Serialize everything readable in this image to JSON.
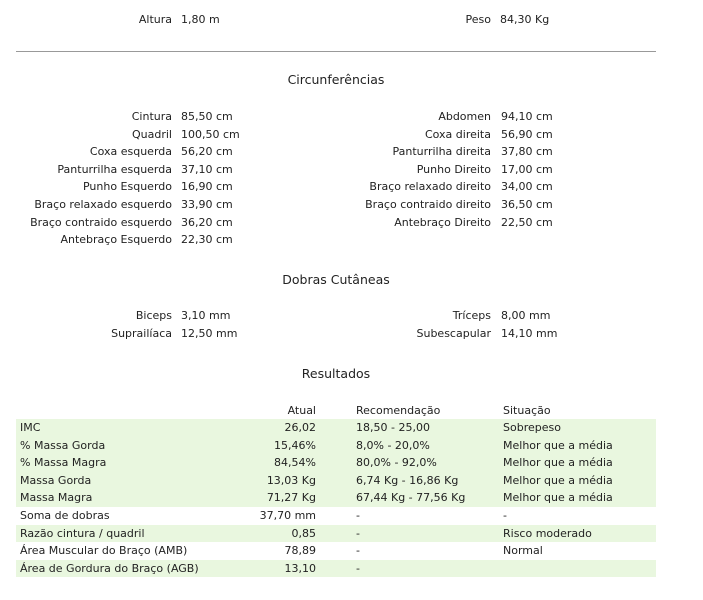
{
  "header": {
    "altura": {
      "label": "Altura",
      "value": "1,80 m"
    },
    "peso": {
      "label": "Peso",
      "value": "84,30 Kg"
    }
  },
  "circunferencias": {
    "title": "Circunferências",
    "left": [
      {
        "label": "Cintura",
        "value": "85,50 cm"
      },
      {
        "label": "Quadril",
        "value": "100,50 cm"
      },
      {
        "label": "Coxa esquerda",
        "value": "56,20 cm"
      },
      {
        "label": "Panturrilha esquerda",
        "value": "37,10 cm"
      },
      {
        "label": "Punho Esquerdo",
        "value": "16,90 cm"
      },
      {
        "label": "Braço relaxado esquerdo",
        "value": "33,90 cm"
      },
      {
        "label": "Braço contraido esquerdo",
        "value": "36,20 cm"
      },
      {
        "label": "Antebraço Esquerdo",
        "value": "22,30 cm"
      }
    ],
    "right": [
      {
        "label": "Abdomen",
        "value": "94,10 cm"
      },
      {
        "label": "Coxa direita",
        "value": "56,90 cm"
      },
      {
        "label": "Panturrilha direita",
        "value": "37,80 cm"
      },
      {
        "label": "Punho Direito",
        "value": "17,00 cm"
      },
      {
        "label": "Braço relaxado direito",
        "value": "34,00 cm"
      },
      {
        "label": "Braço contraido direito",
        "value": "36,50 cm"
      },
      {
        "label": "Antebraço Direito",
        "value": "22,50 cm"
      }
    ]
  },
  "dobras": {
    "title": "Dobras Cutâneas",
    "left": [
      {
        "label": "Biceps",
        "value": "3,10 mm"
      },
      {
        "label": "Suprailíaca",
        "value": "12,50 mm"
      }
    ],
    "right": [
      {
        "label": "Tríceps",
        "value": "8,00 mm"
      },
      {
        "label": "Subescapular",
        "value": "14,10 mm"
      }
    ]
  },
  "resultados": {
    "title": "Resultados",
    "headers": {
      "name": "",
      "atual": "Atual",
      "recomendacao": "Recomendação",
      "situacao": "Situação"
    },
    "rows": [
      {
        "name": "IMC",
        "atual": "26,02",
        "recomendacao": "18,50 - 25,00",
        "situacao": "Sobrepeso",
        "green": true
      },
      {
        "name": "% Massa Gorda",
        "atual": "15,46%",
        "recomendacao": "8,0% - 20,0%",
        "situacao": "Melhor que a média",
        "green": true
      },
      {
        "name": "% Massa Magra",
        "atual": "84,54%",
        "recomendacao": "80,0% - 92,0%",
        "situacao": "Melhor que a média",
        "green": true
      },
      {
        "name": "Massa Gorda",
        "atual": "13,03 Kg",
        "recomendacao": "6,74 Kg - 16,86 Kg",
        "situacao": "Melhor que a média",
        "green": true
      },
      {
        "name": "Massa Magra",
        "atual": "71,27 Kg",
        "recomendacao": "67,44 Kg - 77,56 Kg",
        "situacao": "Melhor que a média",
        "green": true
      },
      {
        "name": "Soma de dobras",
        "atual": "37,70 mm",
        "recomendacao": "-",
        "situacao": "-",
        "green": false
      },
      {
        "name": "Razão cintura / quadril",
        "atual": "0,85",
        "recomendacao": "-",
        "situacao": "Risco moderado",
        "green": true
      },
      {
        "name": "Área Muscular do Braço (AMB)",
        "atual": "78,89",
        "recomendacao": "-",
        "situacao": "Normal",
        "green": false
      },
      {
        "name": "Área de Gordura do Braço (AGB)",
        "atual": "13,10",
        "recomendacao": "-",
        "situacao": "",
        "green": true
      }
    ]
  },
  "colors": {
    "row_green": "#e9f7df",
    "divider": "#999999"
  }
}
